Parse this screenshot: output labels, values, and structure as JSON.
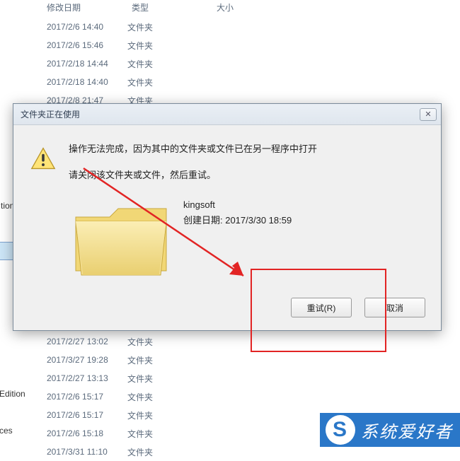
{
  "columns": {
    "date": "修改日期",
    "type": "类型",
    "size": "大小"
  },
  "rows_top": [
    {
      "date": "2017/2/6 14:40",
      "type": "文件夹"
    },
    {
      "date": "2017/2/6 15:46",
      "type": "文件夹"
    },
    {
      "date": "2017/2/18 14:44",
      "type": "文件夹"
    },
    {
      "date": "2017/2/18 14:40",
      "type": "文件夹"
    },
    {
      "date": "2017/2/8 21:47",
      "type": "文件夹"
    }
  ],
  "rows_bottom": [
    {
      "date": "2017/2/27 13:02",
      "type": "文件夹"
    },
    {
      "date": "2017/3/27 19:28",
      "type": "文件夹"
    },
    {
      "date": "2017/2/27 13:13",
      "type": "文件夹"
    },
    {
      "date": "2017/2/6 15:17",
      "type": "文件夹"
    },
    {
      "date": "2017/2/6 15:17",
      "type": "文件夹"
    },
    {
      "date": "2017/2/6 15:18",
      "type": "文件夹"
    },
    {
      "date": "2017/3/31 11:10",
      "type": "文件夹"
    }
  ],
  "sidebar": {
    "item0": "tion",
    "item1": ""
  },
  "sidebar2": {
    "item0": "Edition",
    "item1": "ces"
  },
  "dialog": {
    "title": "文件夹正在使用",
    "line1": "操作无法完成，因为其中的文件夹或文件已在另一程序中打开",
    "line2": "请关闭该文件夹或文件，然后重试。",
    "folder_name": "kingsoft",
    "created_label": "创建日期: 2017/3/30 18:59",
    "retry": "重试(R)",
    "cancel": "取消"
  },
  "watermark": {
    "text": "系统爱好者",
    "logo": "S"
  }
}
